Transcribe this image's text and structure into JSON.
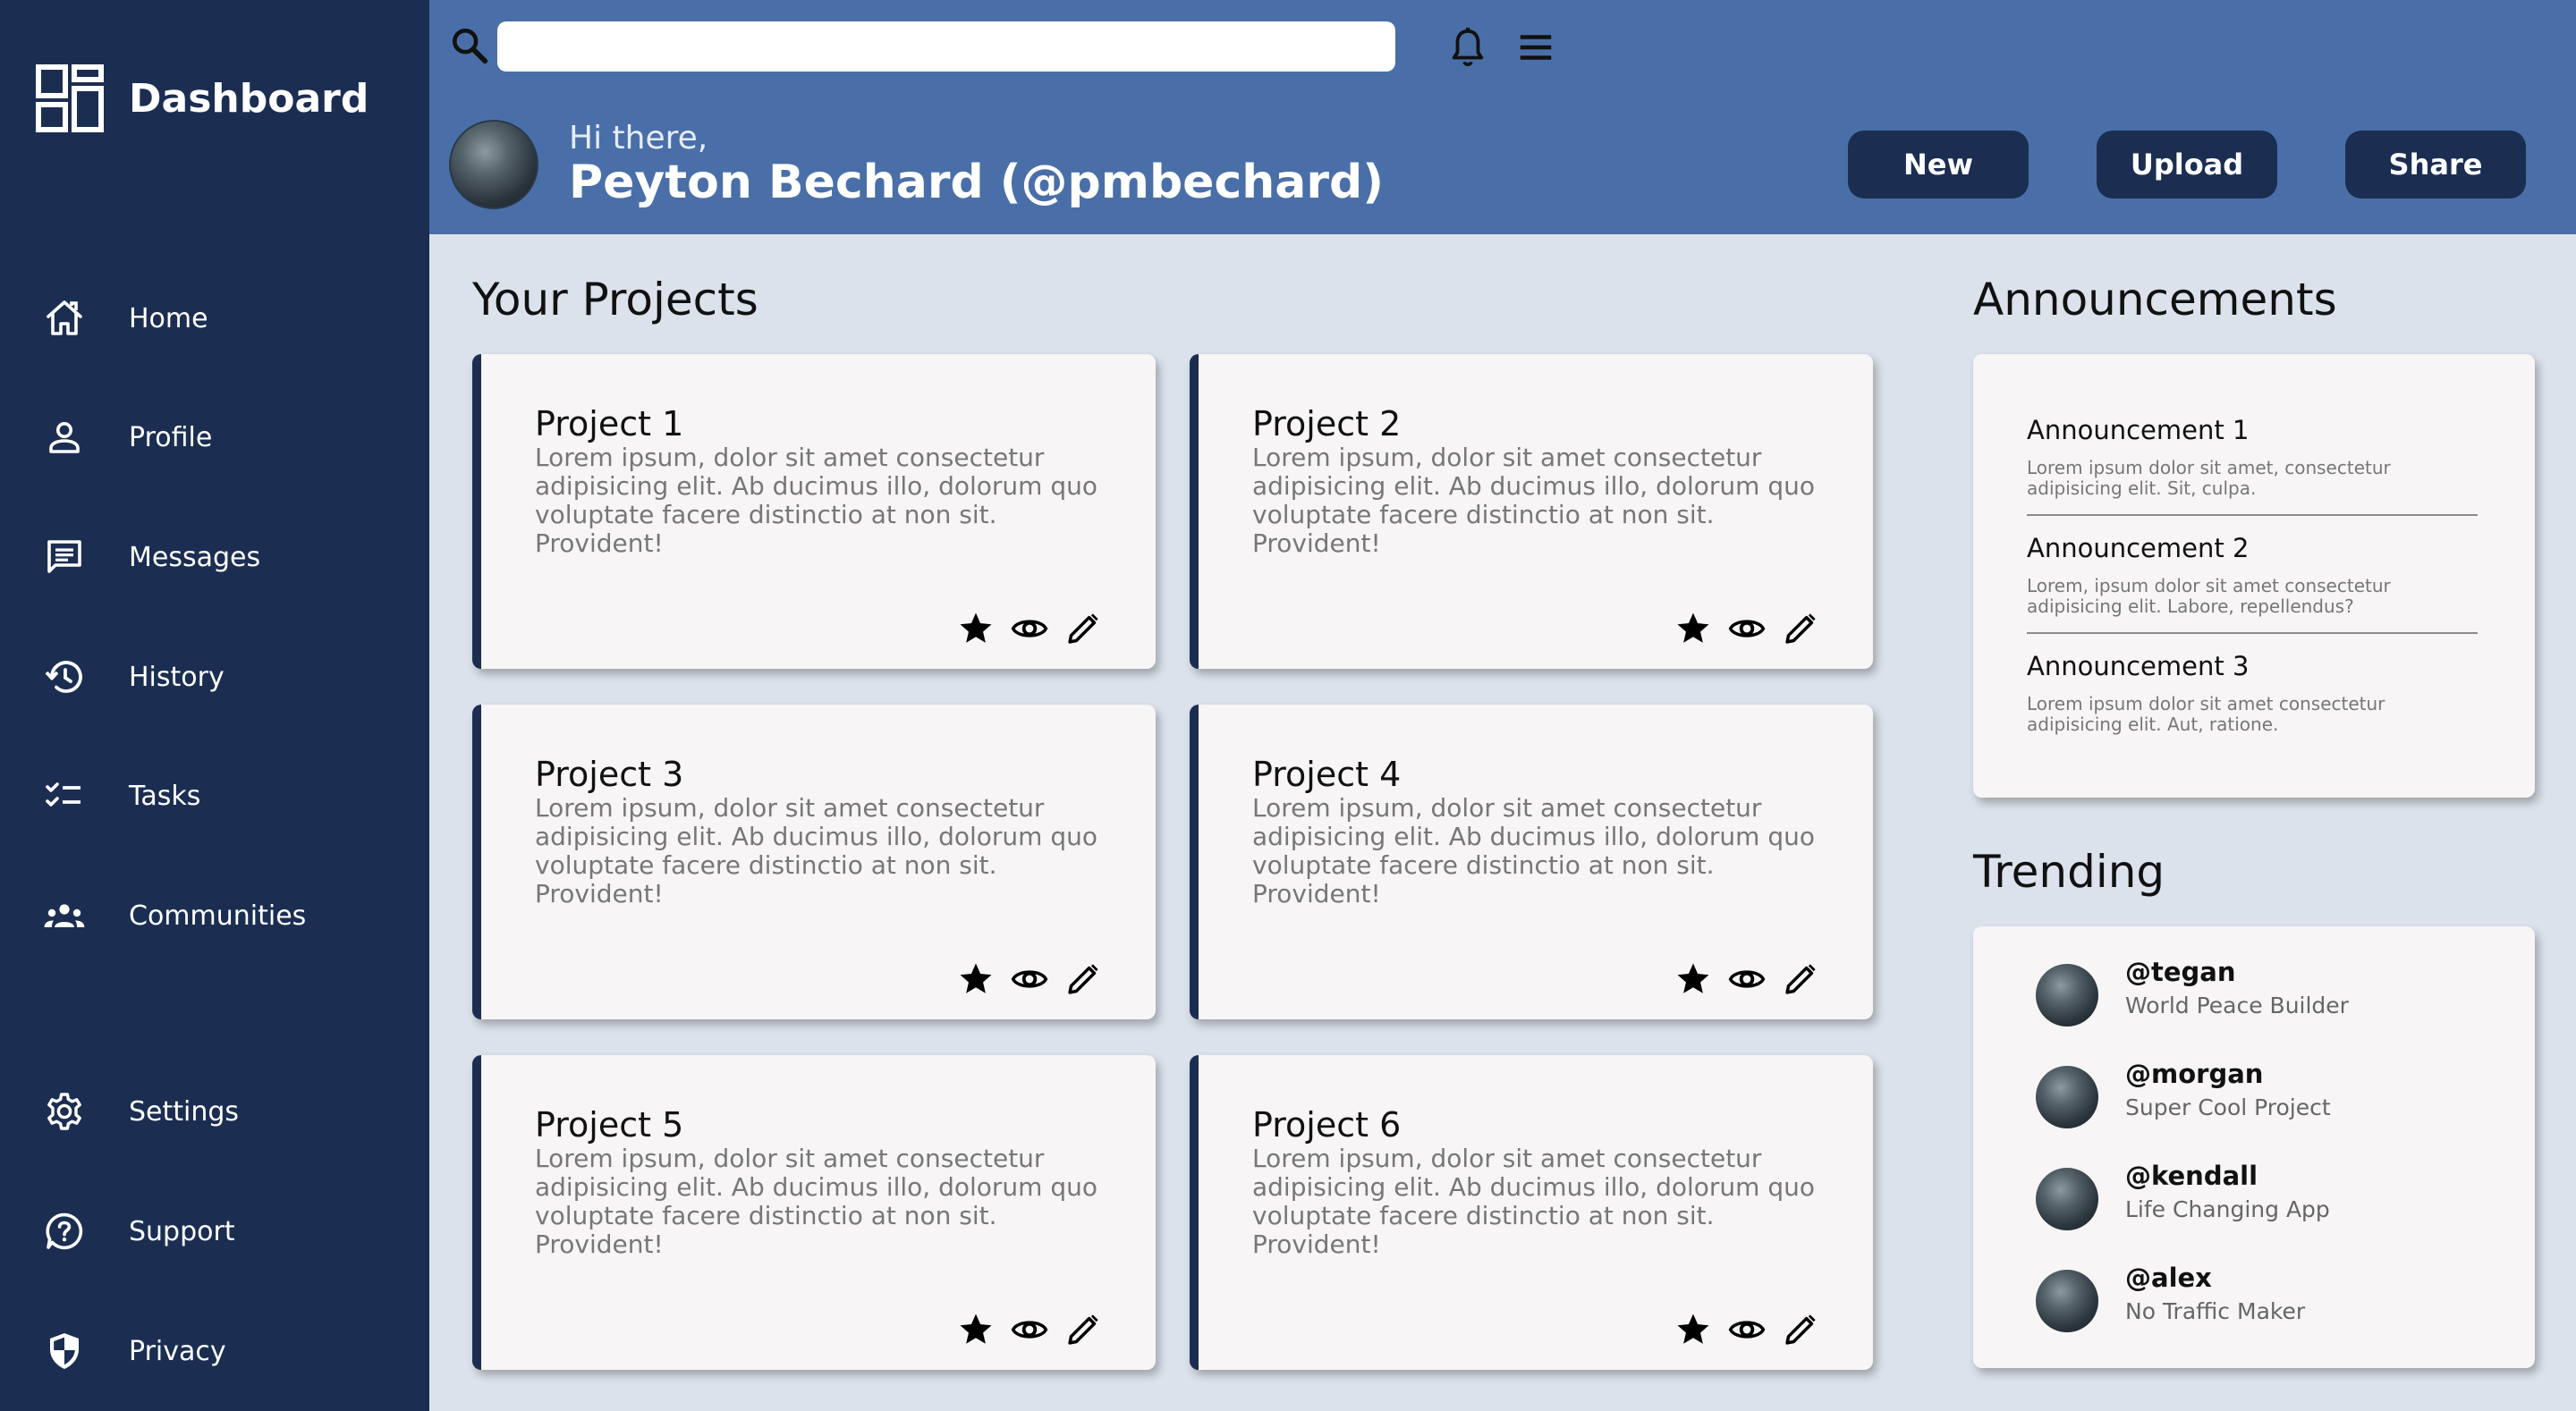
{
  "sidebar": {
    "brand_title": "Dashboard",
    "items": [
      {
        "label": "Home",
        "icon": "home-icon"
      },
      {
        "label": "Profile",
        "icon": "person-icon"
      },
      {
        "label": "Messages",
        "icon": "message-icon"
      },
      {
        "label": "History",
        "icon": "history-icon"
      },
      {
        "label": "Tasks",
        "icon": "tasks-icon"
      },
      {
        "label": "Communities",
        "icon": "group-icon"
      },
      {
        "label": "Settings",
        "icon": "gear-icon"
      },
      {
        "label": "Support",
        "icon": "help-icon"
      },
      {
        "label": "Privacy",
        "icon": "shield-icon"
      }
    ]
  },
  "header": {
    "search_placeholder": "",
    "greeting": "Hi there,",
    "user_name": "Peyton Bechard (@pmbechard)",
    "buttons": {
      "new": "New",
      "upload": "Upload",
      "share": "Share"
    }
  },
  "projects": {
    "title": "Your Projects",
    "items": [
      {
        "title": "Project 1",
        "description": "Lorem ipsum, dolor sit amet consectetur adipisicing elit. Ab ducimus illo, dolorum quo voluptate facere distinctio at non sit. Provident!"
      },
      {
        "title": "Project 2",
        "description": "Lorem ipsum, dolor sit amet consectetur adipisicing elit. Ab ducimus illo, dolorum quo voluptate facere distinctio at non sit. Provident!"
      },
      {
        "title": "Project 3",
        "description": "Lorem ipsum, dolor sit amet consectetur adipisicing elit. Ab ducimus illo, dolorum quo voluptate facere distinctio at non sit. Provident!"
      },
      {
        "title": "Project 4",
        "description": "Lorem ipsum, dolor sit amet consectetur adipisicing elit. Ab ducimus illo, dolorum quo voluptate facere distinctio at non sit. Provident!"
      },
      {
        "title": "Project 5",
        "description": "Lorem ipsum, dolor sit amet consectetur adipisicing elit. Ab ducimus illo, dolorum quo voluptate facere distinctio at non sit. Provident!"
      },
      {
        "title": "Project 6",
        "description": "Lorem ipsum, dolor sit amet consectetur adipisicing elit. Ab ducimus illo, dolorum quo voluptate facere distinctio at non sit. Provident!"
      }
    ]
  },
  "announcements": {
    "title": "Announcements",
    "items": [
      {
        "title": "Announcement 1",
        "body": "Lorem ipsum dolor sit amet, consectetur adipisicing elit. Sit, culpa."
      },
      {
        "title": "Announcement 2",
        "body": "Lorem, ipsum dolor sit amet consectetur adipisicing elit. Labore, repellendus?"
      },
      {
        "title": "Announcement 3",
        "body": "Lorem ipsum dolor sit amet consectetur adipisicing elit. Aut, ratione."
      }
    ]
  },
  "trending": {
    "title": "Trending",
    "items": [
      {
        "handle": "@tegan",
        "project": "World Peace Builder"
      },
      {
        "handle": "@morgan",
        "project": "Super Cool Project"
      },
      {
        "handle": "@kendall",
        "project": "Life Changing App"
      },
      {
        "handle": "@alex",
        "project": "No Traffic Maker"
      }
    ]
  },
  "colors": {
    "sidebar": "#1b2e52",
    "header": "#4a6fa8",
    "background": "#dce2ec",
    "card": "#f7f5f5"
  }
}
